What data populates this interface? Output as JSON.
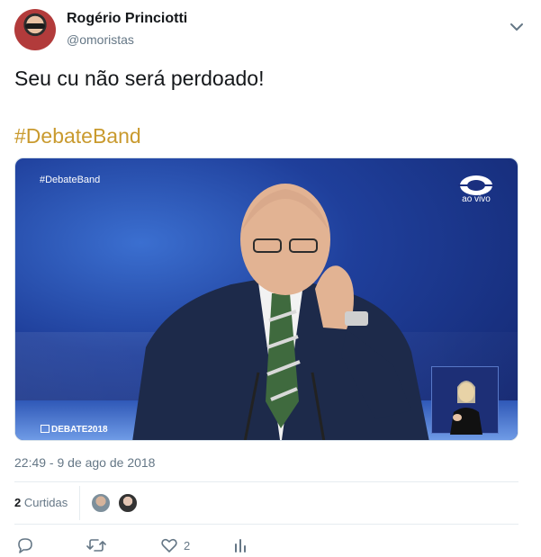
{
  "author": {
    "name": "Rogério Princiotti",
    "handle": "@omoristas"
  },
  "tweet": {
    "text": "Seu cu não será perdoado!",
    "hashtag": "#DebateBand"
  },
  "media": {
    "overlay_hashtag": "#DebateBand",
    "live_label": "ao vivo",
    "debate_label": "DEBATE",
    "debate_year": "2018"
  },
  "meta": {
    "timestamp": "22:49 - 9 de ago de 2018"
  },
  "likes": {
    "count": "2",
    "label": "Curtidas"
  },
  "actions": {
    "like_count": "2"
  },
  "icons": {
    "menu": "chevron-down-icon",
    "reply": "reply-icon",
    "retweet": "retweet-icon",
    "like": "heart-icon",
    "stats": "analytics-icon"
  },
  "colors": {
    "hashtag": "#c99a2e",
    "secondary_text": "#657786",
    "primary_text": "#14171a"
  }
}
